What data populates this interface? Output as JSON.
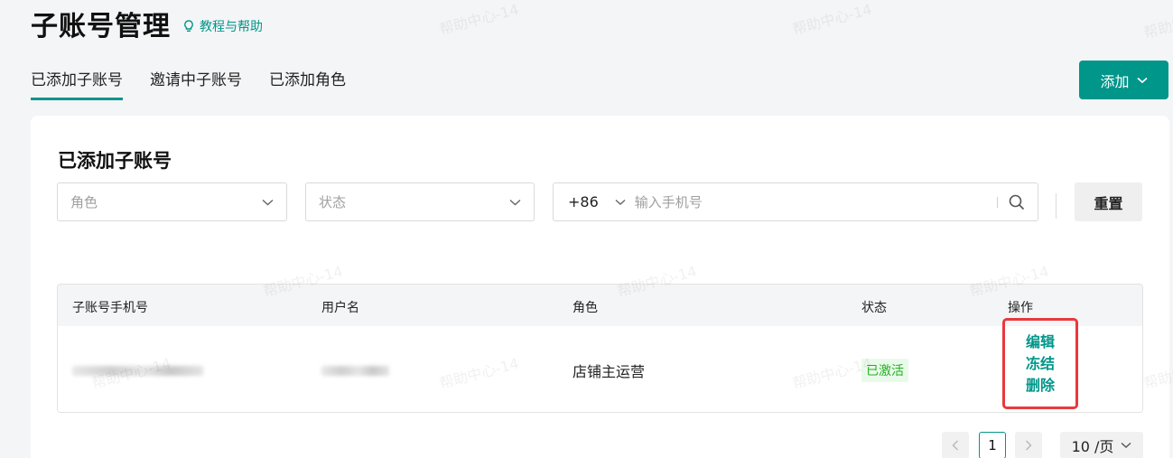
{
  "header": {
    "title": "子账号管理",
    "help_link": "教程与帮助"
  },
  "tabs": [
    {
      "label": "已添加子账号",
      "active": true
    },
    {
      "label": "邀请中子账号",
      "active": false
    },
    {
      "label": "已添加角色",
      "active": false
    }
  ],
  "add_button": {
    "label": "添加"
  },
  "section": {
    "title": "已添加子账号"
  },
  "filters": {
    "role_placeholder": "角色",
    "status_placeholder": "状态",
    "country_code": "+86",
    "phone_placeholder": "输入手机号",
    "reset_label": "重置"
  },
  "table": {
    "columns": [
      "子账号手机号",
      "用户名",
      "角色",
      "状态",
      "操作"
    ],
    "rows": [
      {
        "phone": "",
        "username": "",
        "role": "店铺主运营",
        "status": "已激活",
        "actions": [
          "编辑",
          "冻结",
          "删除"
        ]
      }
    ]
  },
  "pagination": {
    "current_page": "1",
    "page_size": "10 /页"
  },
  "watermark": "帮助中心-14",
  "colors": {
    "accent": "#00968a",
    "status_active_text": "#23b023",
    "status_active_bg": "#eafaea",
    "highlight_box": "#e9383d"
  }
}
